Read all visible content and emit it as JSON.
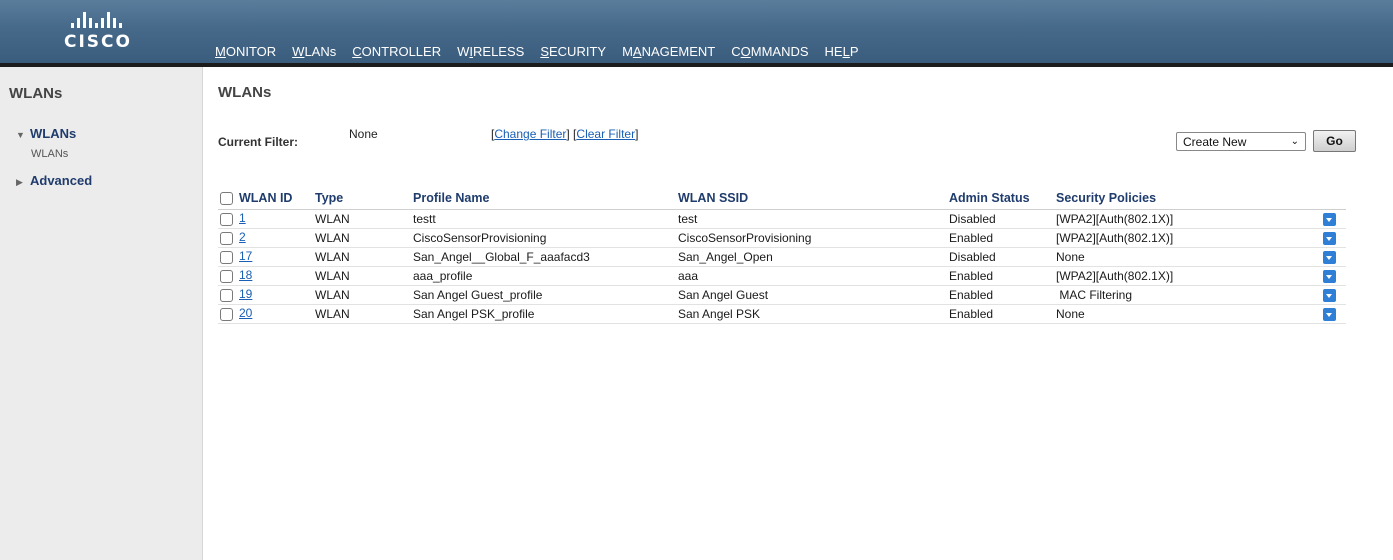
{
  "header": {
    "brand": "CISCO",
    "nav": [
      {
        "pre": "",
        "ul": "M",
        "post": "ONITOR"
      },
      {
        "pre": "",
        "ul": "W",
        "post": "LANs"
      },
      {
        "pre": "",
        "ul": "C",
        "post": "ONTROLLER"
      },
      {
        "pre": "W",
        "ul": "I",
        "post": "RELESS"
      },
      {
        "pre": "",
        "ul": "S",
        "post": "ECURITY"
      },
      {
        "pre": "M",
        "ul": "A",
        "post": "NAGEMENT"
      },
      {
        "pre": "C",
        "ul": "O",
        "post": "MMANDS"
      },
      {
        "pre": "HE",
        "ul": "L",
        "post": "P"
      }
    ],
    "active_index": 1,
    "accent_color": "#e8a33c"
  },
  "sidebar": {
    "title": "WLANs",
    "items": [
      {
        "label": "WLANs",
        "expanded": true,
        "children": [
          "WLANs"
        ]
      },
      {
        "label": "Advanced",
        "expanded": false,
        "children": []
      }
    ]
  },
  "main": {
    "title": "WLANs",
    "filter": {
      "label": "Current Filter:",
      "value": "None",
      "change_link": "Change Filter",
      "clear_link": "Clear Filter"
    },
    "create_select": {
      "selected": "Create New"
    },
    "go_label": "Go",
    "table": {
      "headers": [
        "WLAN ID",
        "Type",
        "Profile Name",
        "WLAN SSID",
        "Admin Status",
        "Security Policies"
      ],
      "rows": [
        {
          "id": "1",
          "type": "WLAN",
          "profile": "testt",
          "ssid": "test",
          "status": "Disabled",
          "security": "[WPA2][Auth(802.1X)]"
        },
        {
          "id": "2",
          "type": "WLAN",
          "profile": "CiscoSensorProvisioning",
          "ssid": "CiscoSensorProvisioning",
          "status": "Enabled",
          "security": "[WPA2][Auth(802.1X)]"
        },
        {
          "id": "17",
          "type": "WLAN",
          "profile": "San_Angel__Global_F_aaafacd3",
          "ssid": "San_Angel_Open",
          "status": "Disabled",
          "security": "None"
        },
        {
          "id": "18",
          "type": "WLAN",
          "profile": "aaa_profile",
          "ssid": "aaa",
          "status": "Enabled",
          "security": "[WPA2][Auth(802.1X)]"
        },
        {
          "id": "19",
          "type": "WLAN",
          "profile": "San Angel Guest_profile",
          "ssid": "San Angel Guest",
          "status": "Enabled",
          "security": " MAC Filtering"
        },
        {
          "id": "20",
          "type": "WLAN",
          "profile": "San Angel PSK_profile",
          "ssid": "San Angel PSK",
          "status": "Enabled",
          "security": "None"
        }
      ]
    }
  }
}
